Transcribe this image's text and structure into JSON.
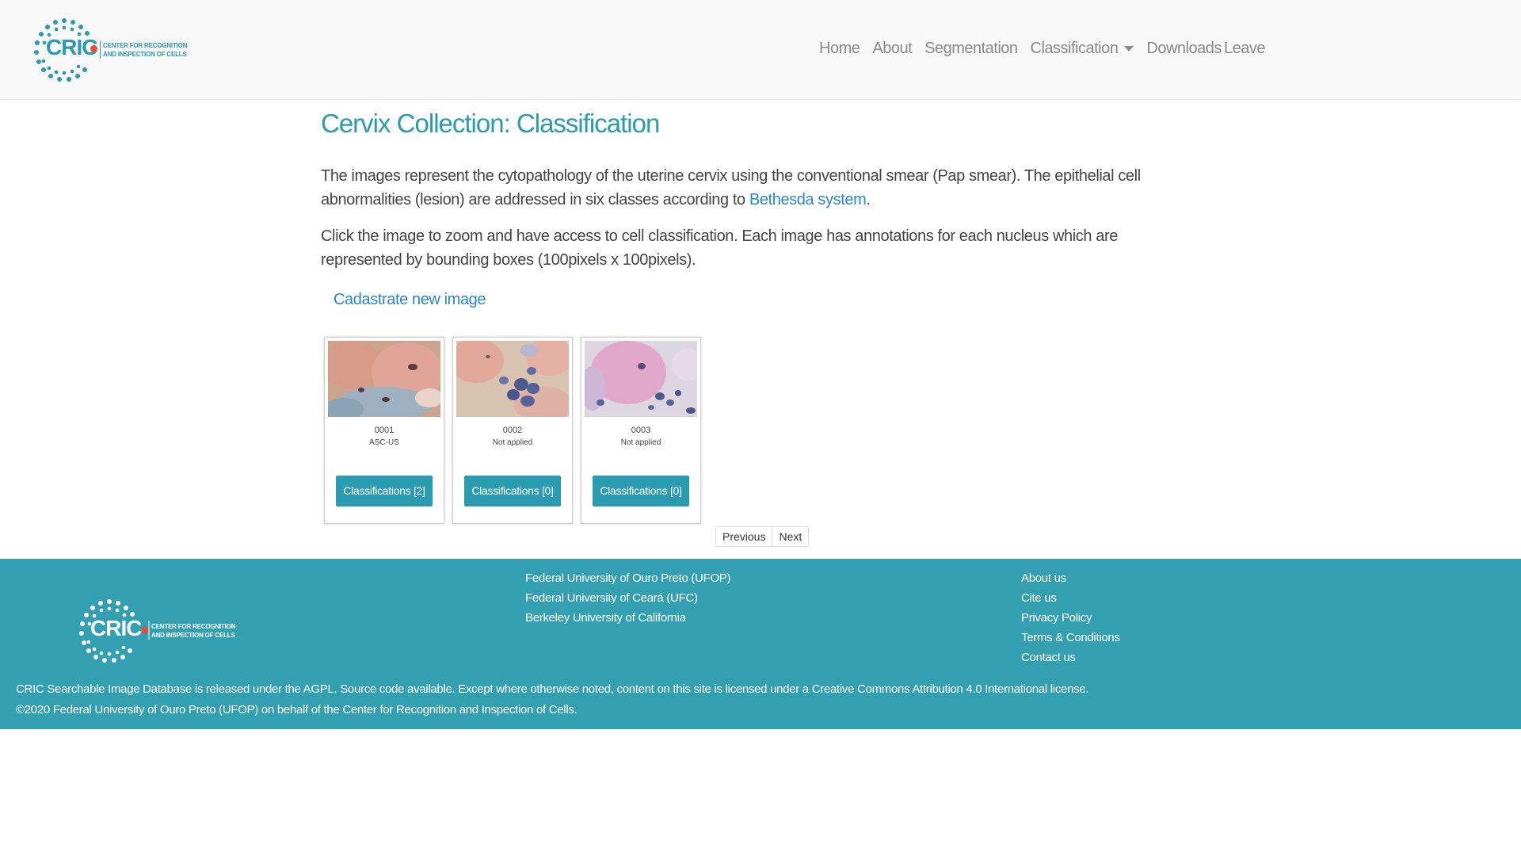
{
  "header": {
    "logo_text_line1": "CENTER FOR RECOGNITION",
    "logo_text_line2": "AND INSPECTION OF CELLS",
    "logo_wordmark": "CRIC",
    "nav": {
      "home": "Home",
      "about": "About",
      "segmentation": "Segmentation",
      "classification": "Classification",
      "downloads": "Downloads",
      "leave": "Leave"
    }
  },
  "main": {
    "title": "Cervix Collection: Classification",
    "para1_before": "The images represent the cytopathology of the uterine cervix using the conventional smear (Pap smear). The epithelial cell abnormalities (lesion) are addressed in six classes according to ",
    "para1_link": "Bethesda system",
    "para1_after": ".",
    "para2": "Click the image to zoom and have access to cell classification. Each image has annotations for each nucleus which are represented by bounding boxes (100pixels x 100pixels).",
    "cadastrate": "Cadastrate new image",
    "cards": [
      {
        "id": "0001",
        "class": "ASC-US",
        "button": "Classifications [2]"
      },
      {
        "id": "0002",
        "class": "Not applied",
        "button": "Classifications [0]"
      },
      {
        "id": "0003",
        "class": "Not applied",
        "button": "Classifications [0]"
      }
    ],
    "pager": {
      "previous": "Previous",
      "next": "Next"
    }
  },
  "footer": {
    "universities": [
      "Federal University of Ouro Preto (UFOP)",
      "Federal University of Ceará (UFC)",
      "Berkeley University of California"
    ],
    "links": [
      "About us",
      "Cite us",
      "Privacy Policy",
      "Terms & Conditions",
      "Contact us"
    ],
    "license_line1": "CRIC Searchable Image Database is released under the AGPL. Source code available. Except where otherwise noted, content on this site is licensed under a Creative Commons Attribution 4.0 International license.",
    "license_line2": "©2020 Federal University of Ouro Preto (UFOP) on behalf of the Center for Recognition and Inspection of Cells."
  },
  "colors": {
    "brand": "#2a9bb0",
    "footer_bg": "#33a0b1",
    "link": "#2b87c9",
    "accent_dot": "#e74c3c"
  }
}
